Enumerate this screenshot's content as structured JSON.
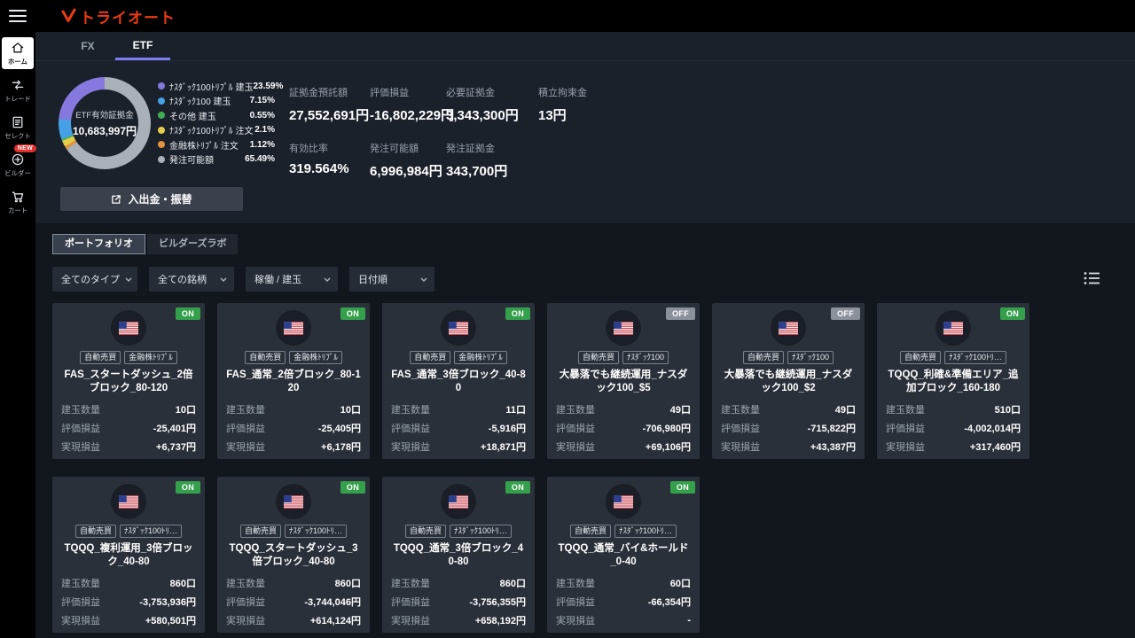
{
  "topbar": {
    "logo_text": "トライオート",
    "logo_color": "#eb3c14"
  },
  "sidebar": {
    "items": [
      {
        "label": "ホーム",
        "active": true
      },
      {
        "label": "トレード",
        "active": false
      },
      {
        "label": "セレクト",
        "active": false
      },
      {
        "label": "ビルダー",
        "active": false,
        "badge": "NEW"
      },
      {
        "label": "カート",
        "active": false
      }
    ]
  },
  "summary": {
    "tabs": [
      {
        "label": "FX",
        "active": false
      },
      {
        "label": "ETF",
        "active": true
      }
    ],
    "accent_color": "#7a7cf0",
    "donut": {
      "center_label": "ETF有効証拠金",
      "center_value": "10,683,997円",
      "segments": [
        {
          "label": "ﾅｽﾀﾞｯｸ100ﾄﾘﾌﾟﾙ 建玉",
          "pct_label": "23.59%",
          "pct": 23.59,
          "color": "#8579e0"
        },
        {
          "label": "ﾅｽﾀﾞｯｸ100 建玉",
          "pct_label": "7.15%",
          "pct": 7.15,
          "color": "#45a0e6"
        },
        {
          "label": "その他 建玉",
          "pct_label": "0.55%",
          "pct": 0.55,
          "color": "#3fae53"
        },
        {
          "label": "ﾅｽﾀﾞｯｸ100ﾄﾘﾌﾟﾙ 注文",
          "pct_label": "2.1%",
          "pct": 2.1,
          "color": "#e3cd4a"
        },
        {
          "label": "金融株ﾄﾘﾌﾟﾙ 注文",
          "pct_label": "1.12%",
          "pct": 1.12,
          "color": "#e2923d"
        },
        {
          "label": "発注可能額",
          "pct_label": "65.49%",
          "pct": 65.49,
          "color": "#aab0b8"
        }
      ]
    },
    "stats_row1": [
      {
        "label": "証拠金預託額",
        "value": "27,552,691円"
      },
      {
        "label": "評価損益",
        "value": "-16,802,229円"
      },
      {
        "label": "必要証拠金",
        "value": "3,343,300円"
      },
      {
        "label": "積立拘束金",
        "value": "13円"
      }
    ],
    "stats_row2": [
      {
        "label": "有効比率",
        "value": "319.564%"
      },
      {
        "label": "発注可能額",
        "value": "6,996,984円"
      },
      {
        "label": "発注証拠金",
        "value": "343,700円"
      }
    ],
    "transfer_button_label": "入出金・振替"
  },
  "portfolio": {
    "tabs": [
      {
        "label": "ポートフォリオ",
        "active": true
      },
      {
        "label": "ビルダーズラボ",
        "active": false
      }
    ],
    "filters": [
      "全てのタイプ",
      "全ての銘柄",
      "稼働 / 建玉",
      "日付順"
    ],
    "status_colors": {
      "on": "#35a04b",
      "off": "#8b919b"
    },
    "card_labels": {
      "qty": "建玉数量",
      "eval": "評価損益",
      "real": "実現損益"
    },
    "cards": [
      {
        "status": "ON",
        "tags": [
          "自動売買",
          "金融株ﾄﾘﾌﾟﾙ"
        ],
        "title": "FAS_スタートダッシュ_2倍ブロック_80-120",
        "qty": "10口",
        "eval": "-25,401円",
        "real": "+6,737円"
      },
      {
        "status": "ON",
        "tags": [
          "自動売買",
          "金融株ﾄﾘﾌﾟﾙ"
        ],
        "title": "FAS_通常_2倍ブロック_80-120",
        "qty": "10口",
        "eval": "-25,405円",
        "real": "+6,178円"
      },
      {
        "status": "ON",
        "tags": [
          "自動売買",
          "金融株ﾄﾘﾌﾟﾙ"
        ],
        "title": "FAS_通常_3倍ブロック_40-80",
        "qty": "11口",
        "eval": "-5,916円",
        "real": "+18,871円"
      },
      {
        "status": "OFF",
        "tags": [
          "自動売買",
          "ﾅｽﾀﾞｯｸ100"
        ],
        "title": "大暴落でも継続運用_ナスダック100_$5",
        "qty": "49口",
        "eval": "-706,980円",
        "real": "+69,106円"
      },
      {
        "status": "OFF",
        "tags": [
          "自動売買",
          "ﾅｽﾀﾞｯｸ100"
        ],
        "title": "大暴落でも継続運用_ナスダック100_$2",
        "qty": "49口",
        "eval": "-715,822円",
        "real": "+43,387円"
      },
      {
        "status": "ON",
        "tags": [
          "自動売買",
          "ﾅｽﾀﾞｯｸ100ﾄﾘ…"
        ],
        "title": "TQQQ_利確&準備エリア_追加ブロック_160-180",
        "qty": "510口",
        "eval": "-4,002,014円",
        "real": "+317,460円"
      },
      {
        "status": "ON",
        "tags": [
          "自動売買",
          "ﾅｽﾀﾞｯｸ100ﾄﾘ…"
        ],
        "title": "TQQQ_複利運用_3倍ブロック_40-80",
        "qty": "860口",
        "eval": "-3,753,936円",
        "real": "+580,501円"
      },
      {
        "status": "ON",
        "tags": [
          "自動売買",
          "ﾅｽﾀﾞｯｸ100ﾄﾘ…"
        ],
        "title": "TQQQ_スタートダッシュ_3倍ブロック_40-80",
        "qty": "860口",
        "eval": "-3,744,046円",
        "real": "+614,124円"
      },
      {
        "status": "ON",
        "tags": [
          "自動売買",
          "ﾅｽﾀﾞｯｸ100ﾄﾘ…"
        ],
        "title": "TQQQ_通常_3倍ブロック_40-80",
        "qty": "860口",
        "eval": "-3,756,355円",
        "real": "+658,192円"
      },
      {
        "status": "ON",
        "tags": [
          "自動売買",
          "ﾅｽﾀﾞｯｸ100ﾄﾘ…"
        ],
        "title": "TQQQ_通常_バイ&ホールド_0-40",
        "qty": "60口",
        "eval": "-66,354円",
        "real": "-"
      }
    ]
  }
}
